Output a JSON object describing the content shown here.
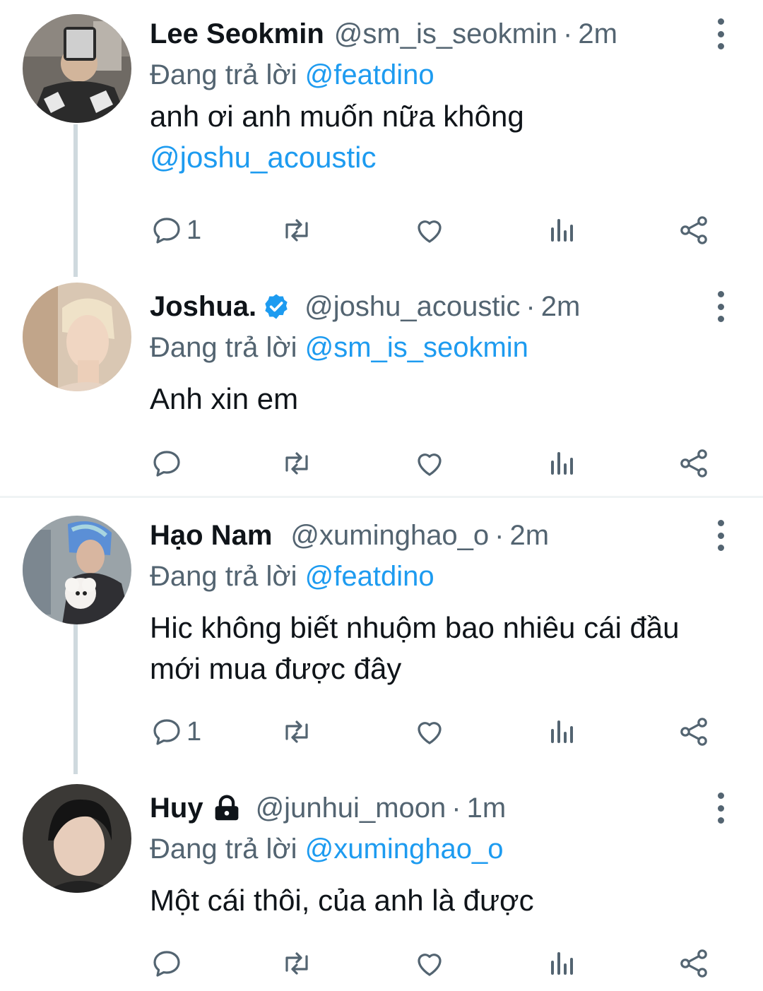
{
  "colors": {
    "accent": "#1d9bf0",
    "secondary": "#536471",
    "text": "#0f1419",
    "thread_line": "#cfd9de"
  },
  "tweets": [
    {
      "name": "Lee Seokmin",
      "handle": "@sm_is_seokmin",
      "time": "2m",
      "reply_prefix": "Đang trả lời",
      "reply_to": "@featdino",
      "text_parts": [
        "anh ơi anh muốn nữa không",
        "@joshu_acoustic"
      ],
      "reply_count": "1",
      "avatar_icon": "avatar-photo"
    },
    {
      "name": "Joshua.",
      "verified": true,
      "handle": "@joshu_acoustic",
      "time": "2m",
      "reply_prefix": "Đang trả lời",
      "reply_to": "@sm_is_seokmin",
      "text": "Anh xin em",
      "reply_count": "",
      "avatar_icon": "avatar-photo"
    },
    {
      "name": "Hạo Nam",
      "handle": "@xuminghao_o",
      "time": "2m",
      "reply_prefix": "Đang trả lời",
      "reply_to": "@featdino",
      "text": "Hic không biết nhuộm bao nhiêu cái đầu mới mua được đây",
      "reply_count": "1",
      "avatar_icon": "avatar-photo"
    },
    {
      "name": "Huy",
      "protected": true,
      "handle": "@junhui_moon",
      "time": "1m",
      "reply_prefix": "Đang trả lời",
      "reply_to": "@xuminghao_o",
      "text": "Một cái thôi, của anh là được",
      "reply_count": "",
      "avatar_icon": "avatar-photo"
    }
  ],
  "separator": "·",
  "icons": [
    "reply-icon",
    "retweet-icon",
    "like-icon",
    "analytics-icon",
    "share-icon",
    "more-icon",
    "verified-icon",
    "lock-icon"
  ]
}
